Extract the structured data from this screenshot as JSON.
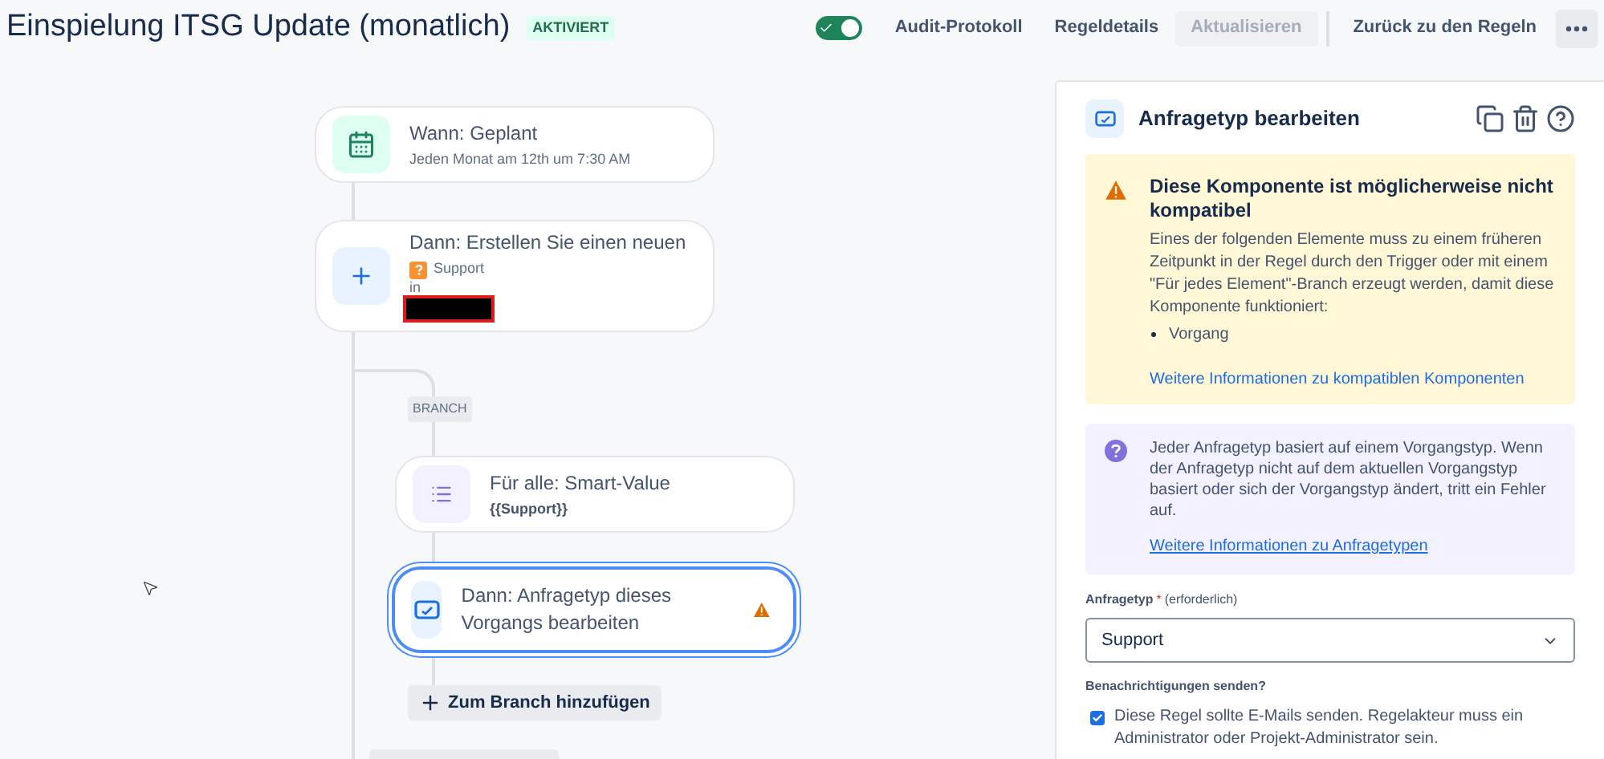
{
  "header": {
    "title": "Einspielung ITSG Update (monatlich)",
    "status_badge": "AKTIVIERT",
    "toggle": {
      "on": true
    },
    "buttons": [
      {
        "label": "Audit-Protokoll",
        "disabled": false
      },
      {
        "label": "Regeldetails",
        "disabled": false
      },
      {
        "label": "Aktualisieren",
        "disabled": true
      },
      {
        "label": "Zurück zu den Regeln",
        "disabled": false
      }
    ]
  },
  "canvas": {
    "nodes": [
      {
        "kind": "trigger",
        "title": "Wann: Geplant",
        "subtitle": "Jeden Monat am 12th um 7:30 AM",
        "selected": false,
        "warning": false
      },
      {
        "kind": "create",
        "title": "Dann: Erstellen Sie einen neuen",
        "issue_type": "Support",
        "location_label": "in",
        "selected": false,
        "warning": false
      }
    ],
    "branch_label": "BRANCH",
    "branch_nodes": [
      {
        "kind": "branch",
        "title": "Für alle: Smart-Value",
        "subtitle": "{{Support}}",
        "selected": false,
        "warning": false
      },
      {
        "kind": "edit",
        "title": "Dann: Anfragetyp dieses Vorgangs bearbeiten",
        "selected": true,
        "warning": true
      }
    ],
    "add_button": "Zum Branch hinzufügen"
  },
  "panel": {
    "title": "Anfragetyp bearbeiten",
    "warning": {
      "title": "Diese Komponente ist möglicherweise nicht kompatibel",
      "body": "Eines der folgenden Elemente muss zu einem früheren Zeitpunkt in der Regel durch den Trigger oder mit einem \"Für jedes Element\"-Branch erzeugt werden, damit diese Komponente funktioniert:",
      "items": [
        "Vorgang"
      ],
      "link": "Weitere Informationen zu kompatiblen Komponenten"
    },
    "info": {
      "text": "Jeder Anfragetyp basiert auf einem Vorgangstyp. Wenn der Anfragetyp nicht auf dem aktuellen Vorgangstyp basiert oder sich der Vorgangstyp ändert, tritt ein Fehler auf.",
      "link": "Weitere Informationen zu Anfragetypen"
    },
    "field": {
      "label": "Anfragetyp",
      "required_mark": "*",
      "required_note": "(erforderlich)",
      "value": "Support"
    },
    "notifications": {
      "label": "Benachrichtigungen senden?",
      "checked": true,
      "text": "Diese Regel sollte E-Mails senden. Regelakteur muss ein Administrator oder Projekt-Administrator sein."
    }
  }
}
